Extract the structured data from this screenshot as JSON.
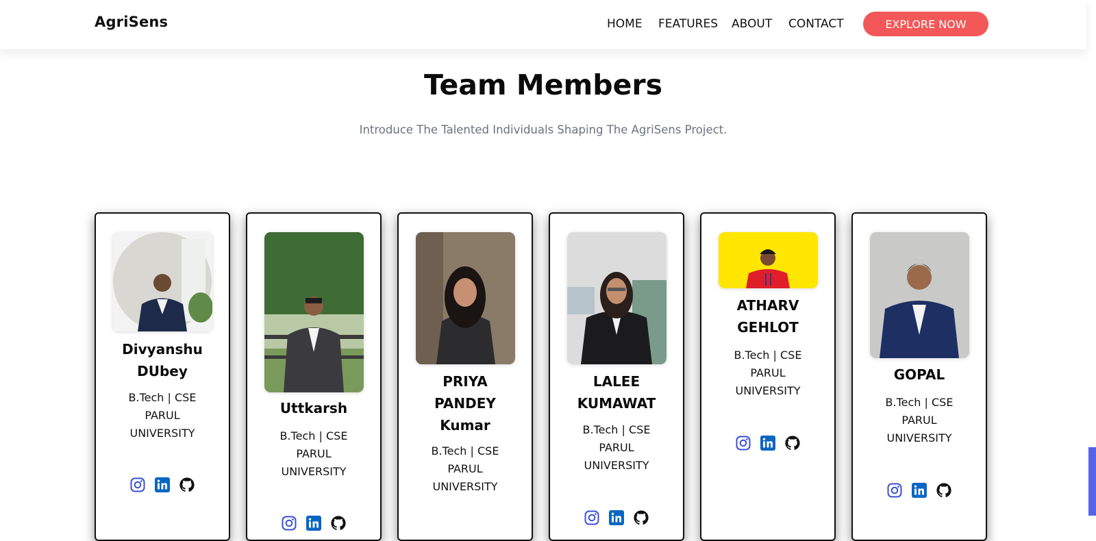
{
  "nav": {
    "brand": "AgriSens",
    "links": [
      "HOME",
      "FEATURES",
      "ABOUT",
      "CONTACT"
    ],
    "cta": "EXPLORE NOW"
  },
  "section": {
    "title": "Team Members",
    "subtitle": "Introduce The Talented Individuals Shaping The AgriSens Project."
  },
  "members": [
    {
      "name_lines": [
        "Divyanshu",
        "DUbey"
      ],
      "degree": "B.Tech | CSE",
      "university_line1": "PARUL",
      "university_line2": "UNIVERSITY",
      "socials": [
        "instagram-icon",
        "linkedin-icon",
        "github-icon"
      ]
    },
    {
      "name_lines": [
        "Uttkarsh"
      ],
      "degree": "B.Tech | CSE",
      "university_line1": "PARUL",
      "university_line2": "UNIVERSITY",
      "socials": [
        "instagram-icon",
        "linkedin-icon",
        "github-icon"
      ]
    },
    {
      "name_lines": [
        "PRIYA",
        "PANDEY",
        "Kumar"
      ],
      "degree": "B.Tech | CSE",
      "university_line1": "PARUL",
      "university_line2": "UNIVERSITY",
      "socials": [
        "instagram-icon",
        "linkedin-icon",
        "github-icon"
      ]
    },
    {
      "name_lines": [
        "LALEE",
        "KUMAWAT"
      ],
      "degree": "B.Tech | CSE",
      "university_line1": "PARUL",
      "university_line2": "UNIVERSITY",
      "socials": [
        "instagram-icon",
        "linkedin-icon",
        "github-icon"
      ]
    },
    {
      "name_lines": [
        "ATHARV",
        "GEHLOT"
      ],
      "degree": "B.Tech | CSE",
      "university_line1": "PARUL",
      "university_line2": "UNIVERSITY",
      "socials": [
        "instagram-icon",
        "linkedin-icon",
        "github-icon"
      ]
    },
    {
      "name_lines": [
        "GOPAL"
      ],
      "degree": "B.Tech | CSE",
      "university_line1": "PARUL",
      "university_line2": "UNIVERSITY",
      "socials": [
        "instagram-icon",
        "linkedin-icon",
        "github-icon"
      ]
    }
  ],
  "colors": {
    "accent": "#f45757",
    "instagram": "#3b4fd6",
    "linkedin": "#0a66c2",
    "github": "#111111",
    "subtitle": "#6b7280"
  }
}
